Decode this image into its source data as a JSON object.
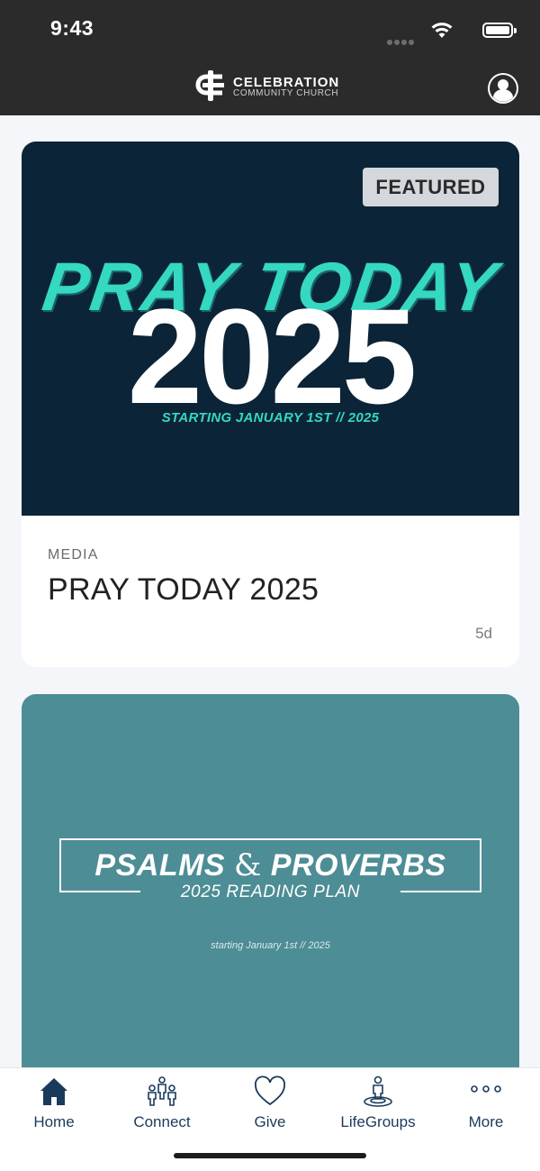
{
  "status_bar": {
    "time": "9:43"
  },
  "header": {
    "brand_name": "CELEBRATION",
    "brand_sub": "COMMUNITY CHURCH"
  },
  "cards": [
    {
      "badge": "FEATURED",
      "art_script": "PRAY TODAY",
      "art_year": "2025",
      "art_tagline": "STARTING JANUARY 1ST // 2025",
      "kicker": "MEDIA",
      "title": "PRAY TODAY 2025",
      "age": "5d",
      "hero_color": "#0c2437",
      "accent_color": "#35d8c0"
    },
    {
      "art_title_left": "PSALMS",
      "art_amp": "&",
      "art_title_right": "PROVERBS",
      "art_subtitle": "2025 READING PLAN",
      "art_tagline": "starting January 1st // 2025",
      "hero_color": "#4d8d95"
    }
  ],
  "tabbar": {
    "tabs": [
      {
        "label": "Home",
        "icon": "home-icon",
        "selected": true
      },
      {
        "label": "Connect",
        "icon": "people-icon"
      },
      {
        "label": "Give",
        "icon": "heart-icon"
      },
      {
        "label": "LifeGroups",
        "icon": "person-location-icon"
      },
      {
        "label": "More",
        "icon": "more-dots-icon"
      }
    ],
    "color": "#1a3a5c"
  },
  "theme": {
    "header_bg": "#2b2b2b",
    "page_bg": "#f4f6fa"
  }
}
